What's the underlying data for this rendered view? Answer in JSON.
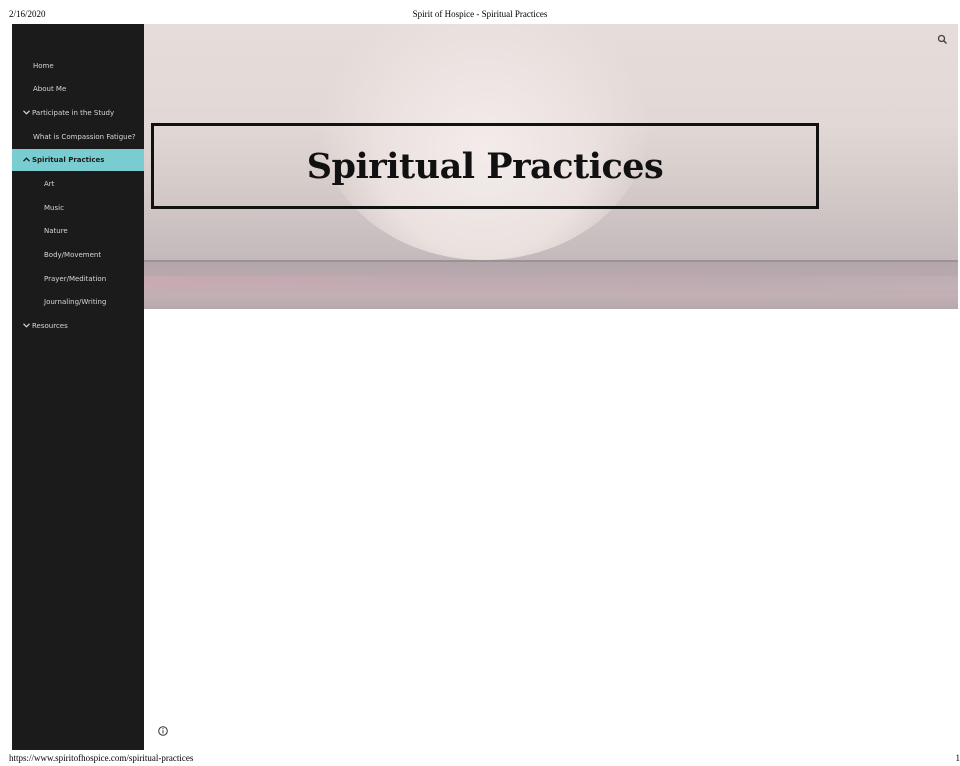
{
  "print_header": {
    "date": "2/16/2020",
    "title": "Spirit of Hospice - Spiritual Practices"
  },
  "print_footer": {
    "url": "https://www.spiritofhospice.com/spiritual-practices",
    "page": "1"
  },
  "sidebar": {
    "items": [
      {
        "label": "Home"
      },
      {
        "label": "About Me"
      },
      {
        "label": "Participate in the Study",
        "caret": "down"
      },
      {
        "label": "What is Compassion Fatigue?"
      },
      {
        "label": "Spiritual Practices",
        "caret": "up",
        "active": true
      },
      {
        "label": "Art"
      },
      {
        "label": "Music"
      },
      {
        "label": "Nature"
      },
      {
        "label": "Body/Movement"
      },
      {
        "label": "Prayer/Meditation"
      },
      {
        "label": "Journaling/Writing"
      },
      {
        "label": "Resources",
        "caret": "down"
      }
    ]
  },
  "hero": {
    "title": "Spiritual Practices"
  },
  "icons": {
    "search": "search-icon",
    "info": "info-icon",
    "caret_down": "chevron-down-icon",
    "caret_up": "chevron-up-icon"
  },
  "colors": {
    "sidebar_bg": "#1b1b1b",
    "active_bg": "#79cdd1",
    "nav_text": "#d6d6d6"
  }
}
